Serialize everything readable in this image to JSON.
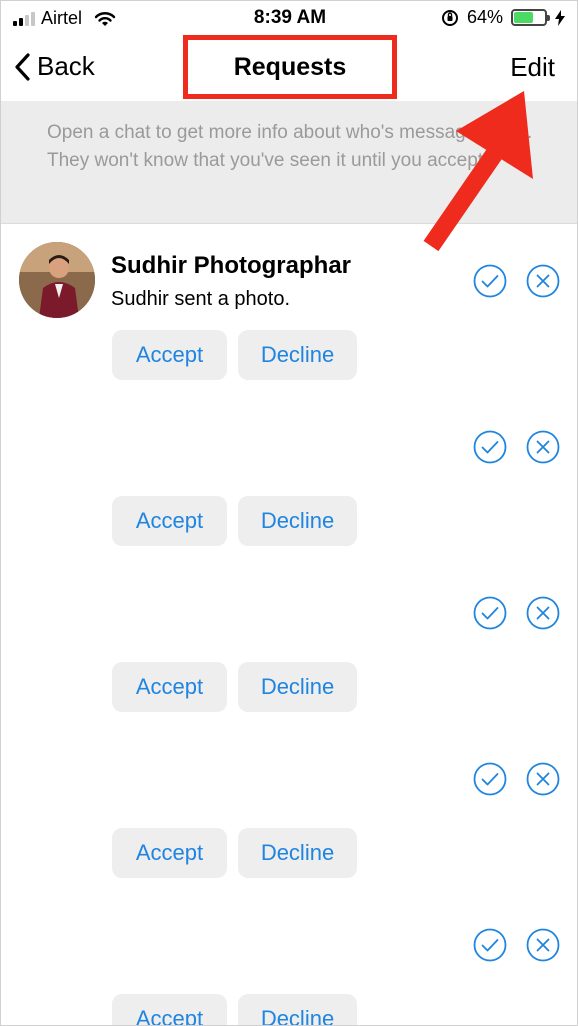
{
  "status_bar": {
    "carrier": "Airtel",
    "time": "8:39 AM",
    "battery": "64%",
    "battery_level": 0.64
  },
  "nav": {
    "back_label": "Back",
    "title": "Requests",
    "edit_label": "Edit"
  },
  "info": {
    "text": "Open a chat to get more info about who's messaging you. They won't know that you've seen it until you accept."
  },
  "requests": [
    {
      "name": "Sudhir Photographar",
      "preview": "Sudhir sent a photo.",
      "accept_label": "Accept",
      "decline_label": "Decline"
    },
    {
      "name": "",
      "preview": "",
      "accept_label": "Accept",
      "decline_label": "Decline"
    },
    {
      "name": "",
      "preview": "",
      "accept_label": "Accept",
      "decline_label": "Decline"
    },
    {
      "name": "",
      "preview": "",
      "accept_label": "Accept",
      "decline_label": "Decline"
    },
    {
      "name": "",
      "preview": "",
      "accept_label": "Accept",
      "decline_label": "Decline"
    }
  ],
  "icons": {
    "accept": "check-circle-icon",
    "decline": "x-circle-icon",
    "back": "chevron-left-icon"
  },
  "colors": {
    "accent": "#1f85e0",
    "annotation": "#ee2b1c",
    "banner_bg": "#ececec",
    "banner_text": "#9a9a9a",
    "button_bg": "#eeeeee"
  }
}
